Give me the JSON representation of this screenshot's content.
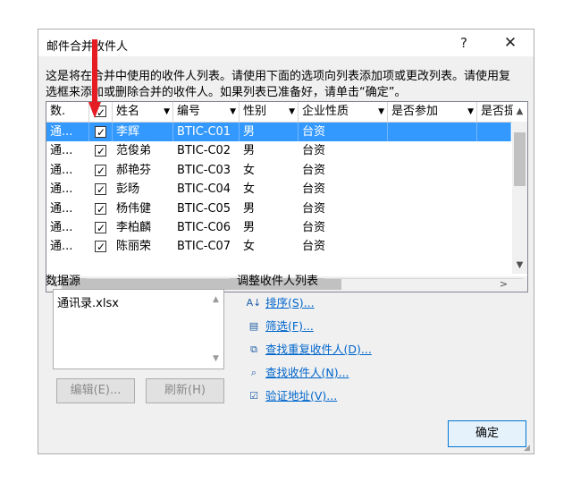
{
  "window": {
    "title": "邮件合并收件人",
    "help": "?",
    "close": "✕"
  },
  "description": {
    "line1": "这是将在合并中使用的收件人列表。请使用下面的选项向列表添加项或更改列表。请使用复",
    "line2": "选框来添加或删除合并的收件人。如果列表已准备好，请单击“确定”。"
  },
  "grid": {
    "headers": [
      "数.",
      "✓",
      "姓名",
      "编号",
      "性别",
      "企业性质",
      "是否参加",
      "是否提"
    ],
    "rows": [
      {
        "src": "通...",
        "name": "李辉",
        "id": "BTIC-C01",
        "sex": "男",
        "type": "台资",
        "selected": true
      },
      {
        "src": "通...",
        "name": "范俊弟",
        "id": "BTIC-C02",
        "sex": "男",
        "type": "台资",
        "selected": false
      },
      {
        "src": "通...",
        "name": "郝艳芬",
        "id": "BTIC-C03",
        "sex": "女",
        "type": "台资",
        "selected": false
      },
      {
        "src": "通...",
        "name": "彭旸",
        "id": "BTIC-C04",
        "sex": "女",
        "type": "台资",
        "selected": false
      },
      {
        "src": "通...",
        "name": "杨伟健",
        "id": "BTIC-C05",
        "sex": "男",
        "type": "台资",
        "selected": false
      },
      {
        "src": "通...",
        "name": "李柏麟",
        "id": "BTIC-C06",
        "sex": "男",
        "type": "台资",
        "selected": false
      },
      {
        "src": "通...",
        "name": "陈丽荣",
        "id": "BTIC-C07",
        "sex": "女",
        "type": "台资",
        "selected": false
      }
    ]
  },
  "datasource": {
    "label": "数据源",
    "file": "通讯录.xlsx",
    "edit_button": "编辑(E)...",
    "refresh_button": "刷新(H)"
  },
  "adjust": {
    "label": "调整收件人列表",
    "links": [
      "排序(S)...",
      "筛选(F)...",
      "查找重复收件人(D)...",
      "查找收件人(N)...",
      "验证地址(V)..."
    ]
  },
  "ok_button": "确定",
  "colors": {
    "selection": "#3399ff",
    "link": "#0066cc",
    "arrow": "#e51c23"
  }
}
